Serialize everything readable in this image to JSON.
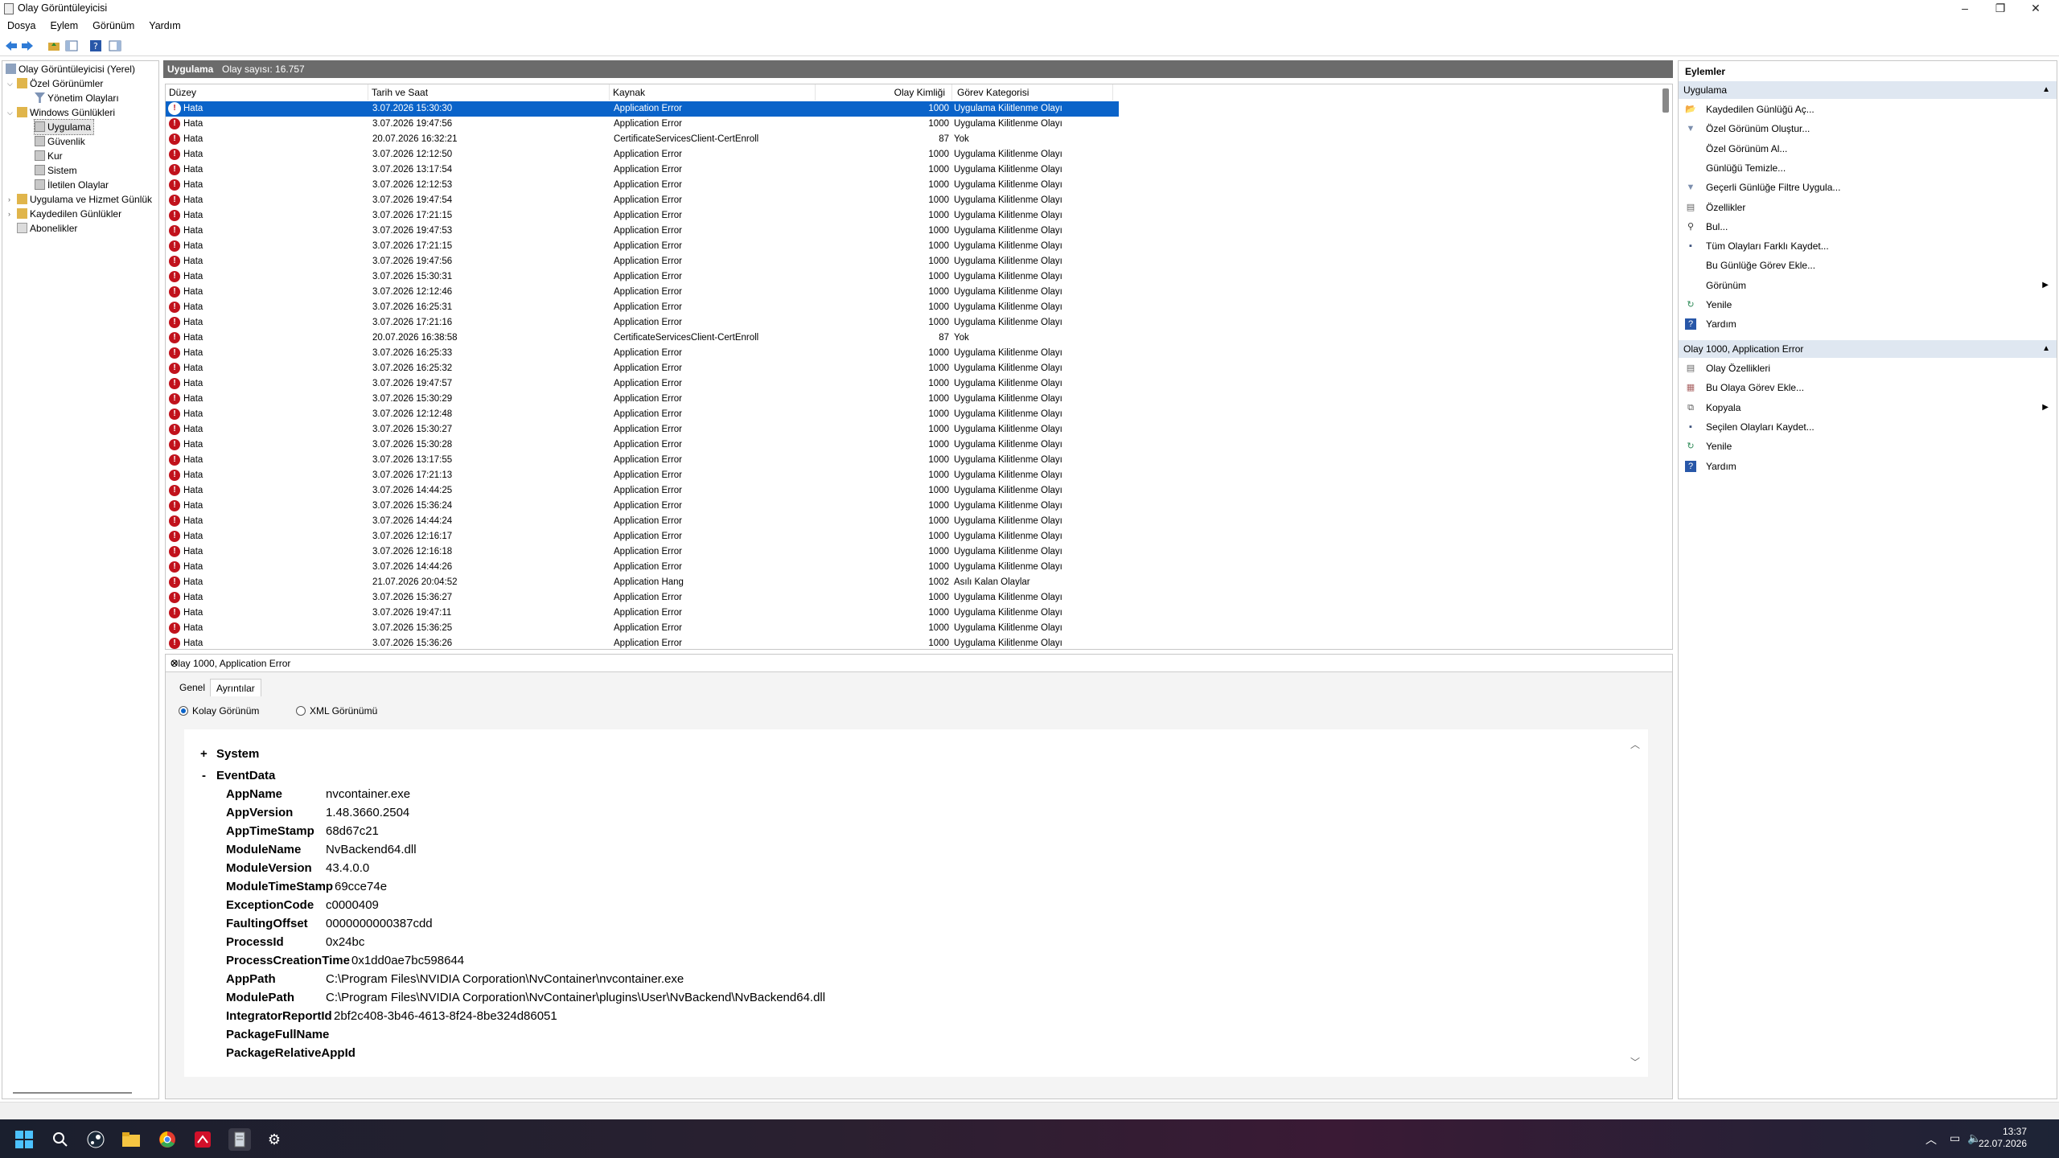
{
  "window": {
    "title": "Olay Görüntüleyicisi"
  },
  "menu": [
    "Dosya",
    "Eylem",
    "Görünüm",
    "Yardım"
  ],
  "tree": {
    "root": "Olay Görüntüleyicisi (Yerel)",
    "custom_views": "Özel Görünümler",
    "admin_events": "Yönetim Olayları",
    "windows_logs": "Windows Günlükleri",
    "application": "Uygulama",
    "security": "Güvenlik",
    "setup": "Kur",
    "system": "Sistem",
    "forwarded": "İletilen Olaylar",
    "app_service_logs": "Uygulama ve Hizmet Günlük",
    "saved_logs": "Kaydedilen Günlükler",
    "subscriptions": "Abonelikler"
  },
  "center": {
    "title": "Uygulama",
    "count_label": "Olay sayısı: 16.757"
  },
  "grid": {
    "columns": [
      "Düzey",
      "Tarih ve Saat",
      "Kaynak",
      "Olay Kimliği",
      "Görev Kategorisi"
    ],
    "rows": [
      {
        "level": "Hata",
        "date": "3.07.2026 15:30:30",
        "source": "Application Error",
        "id": "1000",
        "cat": "Uygulama Kilitlenme Olayı",
        "sel": true
      },
      {
        "level": "Hata",
        "date": "3.07.2026 19:47:56",
        "source": "Application Error",
        "id": "1000",
        "cat": "Uygulama Kilitlenme Olayı"
      },
      {
        "level": "Hata",
        "date": "20.07.2026 16:32:21",
        "source": "CertificateServicesClient-CertEnroll",
        "id": "87",
        "cat": "Yok"
      },
      {
        "level": "Hata",
        "date": "3.07.2026 12:12:50",
        "source": "Application Error",
        "id": "1000",
        "cat": "Uygulama Kilitlenme Olayı"
      },
      {
        "level": "Hata",
        "date": "3.07.2026 13:17:54",
        "source": "Application Error",
        "id": "1000",
        "cat": "Uygulama Kilitlenme Olayı"
      },
      {
        "level": "Hata",
        "date": "3.07.2026 12:12:53",
        "source": "Application Error",
        "id": "1000",
        "cat": "Uygulama Kilitlenme Olayı"
      },
      {
        "level": "Hata",
        "date": "3.07.2026 19:47:54",
        "source": "Application Error",
        "id": "1000",
        "cat": "Uygulama Kilitlenme Olayı"
      },
      {
        "level": "Hata",
        "date": "3.07.2026 17:21:15",
        "source": "Application Error",
        "id": "1000",
        "cat": "Uygulama Kilitlenme Olayı"
      },
      {
        "level": "Hata",
        "date": "3.07.2026 19:47:53",
        "source": "Application Error",
        "id": "1000",
        "cat": "Uygulama Kilitlenme Olayı"
      },
      {
        "level": "Hata",
        "date": "3.07.2026 17:21:15",
        "source": "Application Error",
        "id": "1000",
        "cat": "Uygulama Kilitlenme Olayı"
      },
      {
        "level": "Hata",
        "date": "3.07.2026 19:47:56",
        "source": "Application Error",
        "id": "1000",
        "cat": "Uygulama Kilitlenme Olayı"
      },
      {
        "level": "Hata",
        "date": "3.07.2026 15:30:31",
        "source": "Application Error",
        "id": "1000",
        "cat": "Uygulama Kilitlenme Olayı"
      },
      {
        "level": "Hata",
        "date": "3.07.2026 12:12:46",
        "source": "Application Error",
        "id": "1000",
        "cat": "Uygulama Kilitlenme Olayı"
      },
      {
        "level": "Hata",
        "date": "3.07.2026 16:25:31",
        "source": "Application Error",
        "id": "1000",
        "cat": "Uygulama Kilitlenme Olayı"
      },
      {
        "level": "Hata",
        "date": "3.07.2026 17:21:16",
        "source": "Application Error",
        "id": "1000",
        "cat": "Uygulama Kilitlenme Olayı"
      },
      {
        "level": "Hata",
        "date": "20.07.2026 16:38:58",
        "source": "CertificateServicesClient-CertEnroll",
        "id": "87",
        "cat": "Yok"
      },
      {
        "level": "Hata",
        "date": "3.07.2026 16:25:33",
        "source": "Application Error",
        "id": "1000",
        "cat": "Uygulama Kilitlenme Olayı"
      },
      {
        "level": "Hata",
        "date": "3.07.2026 16:25:32",
        "source": "Application Error",
        "id": "1000",
        "cat": "Uygulama Kilitlenme Olayı"
      },
      {
        "level": "Hata",
        "date": "3.07.2026 19:47:57",
        "source": "Application Error",
        "id": "1000",
        "cat": "Uygulama Kilitlenme Olayı"
      },
      {
        "level": "Hata",
        "date": "3.07.2026 15:30:29",
        "source": "Application Error",
        "id": "1000",
        "cat": "Uygulama Kilitlenme Olayı"
      },
      {
        "level": "Hata",
        "date": "3.07.2026 12:12:48",
        "source": "Application Error",
        "id": "1000",
        "cat": "Uygulama Kilitlenme Olayı"
      },
      {
        "level": "Hata",
        "date": "3.07.2026 15:30:27",
        "source": "Application Error",
        "id": "1000",
        "cat": "Uygulama Kilitlenme Olayı"
      },
      {
        "level": "Hata",
        "date": "3.07.2026 15:30:28",
        "source": "Application Error",
        "id": "1000",
        "cat": "Uygulama Kilitlenme Olayı"
      },
      {
        "level": "Hata",
        "date": "3.07.2026 13:17:55",
        "source": "Application Error",
        "id": "1000",
        "cat": "Uygulama Kilitlenme Olayı"
      },
      {
        "level": "Hata",
        "date": "3.07.2026 17:21:13",
        "source": "Application Error",
        "id": "1000",
        "cat": "Uygulama Kilitlenme Olayı"
      },
      {
        "level": "Hata",
        "date": "3.07.2026 14:44:25",
        "source": "Application Error",
        "id": "1000",
        "cat": "Uygulama Kilitlenme Olayı"
      },
      {
        "level": "Hata",
        "date": "3.07.2026 15:36:24",
        "source": "Application Error",
        "id": "1000",
        "cat": "Uygulama Kilitlenme Olayı"
      },
      {
        "level": "Hata",
        "date": "3.07.2026 14:44:24",
        "source": "Application Error",
        "id": "1000",
        "cat": "Uygulama Kilitlenme Olayı"
      },
      {
        "level": "Hata",
        "date": "3.07.2026 12:16:17",
        "source": "Application Error",
        "id": "1000",
        "cat": "Uygulama Kilitlenme Olayı"
      },
      {
        "level": "Hata",
        "date": "3.07.2026 12:16:18",
        "source": "Application Error",
        "id": "1000",
        "cat": "Uygulama Kilitlenme Olayı"
      },
      {
        "level": "Hata",
        "date": "3.07.2026 14:44:26",
        "source": "Application Error",
        "id": "1000",
        "cat": "Uygulama Kilitlenme Olayı"
      },
      {
        "level": "Hata",
        "date": "21.07.2026 20:04:52",
        "source": "Application Hang",
        "id": "1002",
        "cat": "Asılı Kalan Olaylar"
      },
      {
        "level": "Hata",
        "date": "3.07.2026 15:36:27",
        "source": "Application Error",
        "id": "1000",
        "cat": "Uygulama Kilitlenme Olayı"
      },
      {
        "level": "Hata",
        "date": "3.07.2026 19:47:11",
        "source": "Application Error",
        "id": "1000",
        "cat": "Uygulama Kilitlenme Olayı"
      },
      {
        "level": "Hata",
        "date": "3.07.2026 15:36:25",
        "source": "Application Error",
        "id": "1000",
        "cat": "Uygulama Kilitlenme Olayı"
      },
      {
        "level": "Hata",
        "date": "3.07.2026 15:36:26",
        "source": "Application Error",
        "id": "1000",
        "cat": "Uygulama Kilitlenme Olayı"
      }
    ]
  },
  "detail": {
    "title": "Olay 1000, Application Error",
    "tabs": [
      "Genel",
      "Ayrıntılar"
    ],
    "radio_friendly": "Kolay Görünüm",
    "radio_xml": "XML Görünümü",
    "system_label": "System",
    "system_sign": "+",
    "eventdata_label": "EventData",
    "eventdata_sign": "-",
    "fields": [
      {
        "k": "AppName",
        "v": "nvcontainer.exe"
      },
      {
        "k": "AppVersion",
        "v": "1.48.3660.2504"
      },
      {
        "k": "AppTimeStamp",
        "v": "68d67c21"
      },
      {
        "k": "ModuleName",
        "v": "NvBackend64.dll"
      },
      {
        "k": "ModuleVersion",
        "v": "43.4.0.0"
      },
      {
        "k": "ModuleTimeStamp",
        "v": "69cce74e"
      },
      {
        "k": "ExceptionCode",
        "v": "c0000409"
      },
      {
        "k": "FaultingOffset",
        "v": "0000000000387cdd"
      },
      {
        "k": "ProcessId",
        "v": "0x24bc"
      },
      {
        "k": "ProcessCreationTime",
        "v": "0x1dd0ae7bc598644"
      },
      {
        "k": "AppPath",
        "v": "C:\\Program Files\\NVIDIA Corporation\\NvContainer\\nvcontainer.exe"
      },
      {
        "k": "ModulePath",
        "v": "C:\\Program Files\\NVIDIA Corporation\\NvContainer\\plugins\\User\\NvBackend\\NvBackend64.dll"
      },
      {
        "k": "IntegratorReportId",
        "v": "2bf2c408-3b46-4613-8f24-8be324d86051"
      },
      {
        "k": "PackageFullName",
        "v": ""
      },
      {
        "k": "PackageRelativeAppId",
        "v": ""
      }
    ]
  },
  "actions": {
    "header": "Eylemler",
    "section1": "Uygulama",
    "items1": [
      {
        "label": "Kaydedilen Günlüğü Aç...",
        "icon": "folder-icon"
      },
      {
        "label": "Özel Görünüm Oluştur...",
        "icon": "filter-icon"
      },
      {
        "label": "Özel Görünüm Al...",
        "icon": ""
      },
      {
        "label": "Günlüğü Temizle...",
        "icon": ""
      },
      {
        "label": "Geçerli Günlüğe Filtre Uygula...",
        "icon": "filter-icon"
      },
      {
        "label": "Özellikler",
        "icon": "properties-icon"
      },
      {
        "label": "Bul...",
        "icon": "binoculars-icon"
      },
      {
        "label": "Tüm Olayları Farklı Kaydet...",
        "icon": "save-icon"
      },
      {
        "label": "Bu Günlüğe Görev Ekle...",
        "icon": ""
      },
      {
        "label": "Görünüm",
        "icon": "",
        "submenu": true
      },
      {
        "label": "Yenile",
        "icon": "refresh-icon"
      },
      {
        "label": "Yardım",
        "icon": "help-icon"
      }
    ],
    "section2": "Olay 1000, Application Error",
    "items2": [
      {
        "label": "Olay Özellikleri",
        "icon": "properties-icon"
      },
      {
        "label": "Bu Olaya Görev Ekle...",
        "icon": "task-icon"
      },
      {
        "label": "Kopyala",
        "icon": "copy-icon",
        "submenu": true
      },
      {
        "label": "Seçilen Olayları Kaydet...",
        "icon": "save-icon"
      },
      {
        "label": "Yenile",
        "icon": "refresh-icon"
      },
      {
        "label": "Yardım",
        "icon": "help-icon"
      }
    ]
  },
  "taskbar": {
    "time": "13:37",
    "date": "22.07.2026"
  },
  "colors": {
    "selection": "#0a63c9",
    "error": "#c1121c",
    "section_bg": "#dfe7f1"
  }
}
